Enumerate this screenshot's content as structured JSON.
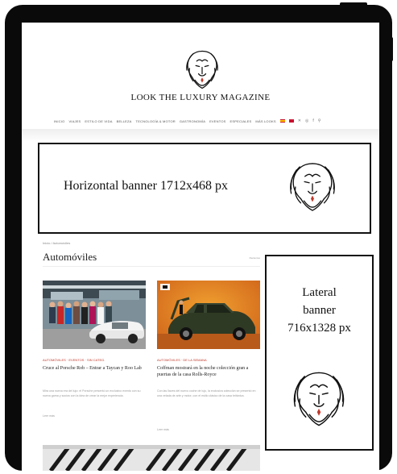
{
  "site": {
    "wordmark": "LOOK THE LUXURY MAGAZINE",
    "logo_icon": "lion-head-icon"
  },
  "nav": {
    "items": [
      "Inicio",
      "Viajes",
      "Estilo de vida",
      "Belleza",
      "Tecnología & Motor",
      "Gastronomía",
      "Eventos",
      "Especiales",
      "Más looks"
    ],
    "social": [
      "x-icon",
      "instagram-icon",
      "facebook-icon",
      "search-icon"
    ]
  },
  "banners": {
    "horizontal": "Horizontal banner 1712x468 px",
    "lateral_lines": [
      "Lateral",
      "banner",
      "716x1328 px"
    ]
  },
  "content": {
    "breadcrumb": "Inicio  /  Automóviles",
    "section_title": "Automóviles",
    "sort_label": "Recientes",
    "cards": [
      {
        "category": "AUTOMÓVILES  ·  EVENTOS  ·  SIN CATEG.",
        "title": "Cruce al Porsche Rob – Entrar a Taycan y Roo Lab",
        "excerpt": "Mira una nueva era del lujo: el Porsche presentó un exclusivo evento con su nueva gama y socios con la idea de crear la mejor experiencia.",
        "more": "Leer más"
      },
      {
        "category": "AUTOMÓVILES  ·  DE LA SEMANA",
        "title": "Coffman mostrará en la noche colección gran a puertas de la casa Rolls-Royce",
        "excerpt": "Con las llaves del nuevo coche de lujo, la exclusiva colección se presentó en una velada de arte y motor, con el estilo clásico de la casa británica.",
        "more": "Leer más"
      }
    ]
  },
  "colors": {
    "frame": "#0a0a0a",
    "accent": "#c0392b"
  }
}
